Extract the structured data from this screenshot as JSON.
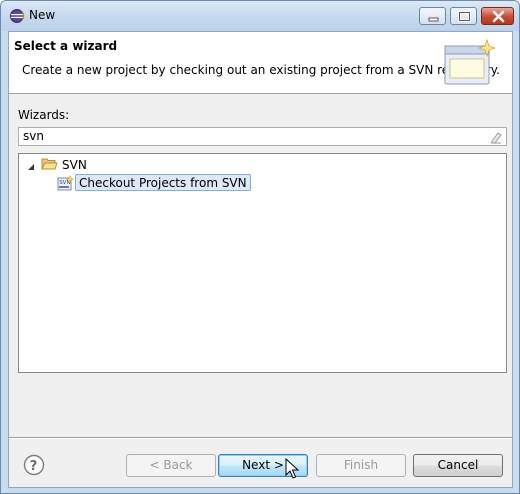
{
  "window": {
    "title": "New",
    "icons": {
      "app": "eclipse-icon",
      "minimize": "minimize-icon",
      "maximize": "maximize-icon",
      "close": "close-icon"
    }
  },
  "banner": {
    "title": "Select a wizard",
    "description": "Create a new project by checking out an existing project from a SVN repository.",
    "graphic": "wizard-window-icon"
  },
  "wizards": {
    "label": "Wizards:",
    "filter_value": "svn",
    "clear_icon": "clear-filter-icon"
  },
  "tree": {
    "items": [
      {
        "label": "SVN",
        "expanded": true,
        "icon": "folder-open-icon"
      },
      {
        "label": "Checkout Projects from SVN",
        "selected": true,
        "icon": "svn-checkout-icon"
      }
    ]
  },
  "buttons": {
    "help_icon": "help-icon",
    "back": "< Back",
    "next": "Next >",
    "finish": "Finish",
    "cancel": "Cancel",
    "back_enabled": false,
    "finish_enabled": false
  },
  "colors": {
    "titlebar": "#c4d8ee",
    "selection_bg": "#dbe9f9",
    "selection_border": "#84acdd",
    "close_button": "#c74b35",
    "default_button_border": "#3c7fb1"
  }
}
